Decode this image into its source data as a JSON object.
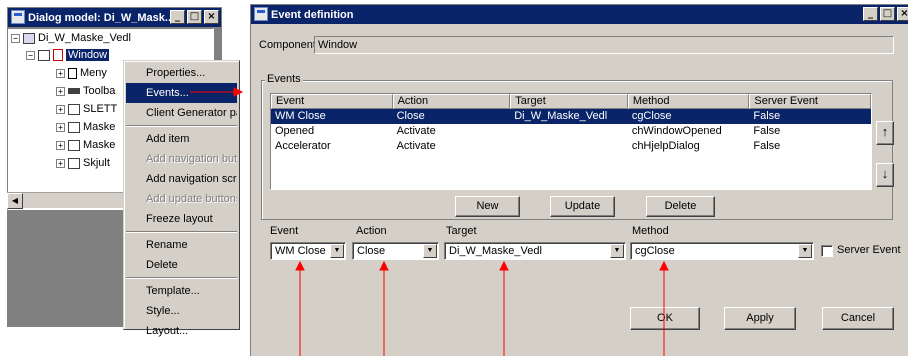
{
  "left_window": {
    "title": "Dialog model: Di_W_Mask...",
    "tree": {
      "root": "Di_W_Maske_Vedl",
      "selected": "Window",
      "children": [
        "Meny",
        "Toolba",
        "SLETT",
        "Maske",
        "Maske",
        "Skjult"
      ]
    }
  },
  "context_menu": {
    "items": [
      {
        "label": "Properties...",
        "state": "normal"
      },
      {
        "label": "Events...",
        "state": "highlighted"
      },
      {
        "label": "Client Generator para",
        "state": "normal"
      },
      {
        "label": "Add item",
        "state": "normal"
      },
      {
        "label": "Add navigation butto",
        "state": "disabled"
      },
      {
        "label": "Add navigation scroll",
        "state": "normal"
      },
      {
        "label": "Add update buttons",
        "state": "disabled"
      },
      {
        "label": "Freeze layout",
        "state": "normal"
      },
      {
        "label": "Rename",
        "state": "normal"
      },
      {
        "label": "Delete",
        "state": "normal"
      },
      {
        "label": "Template...",
        "state": "normal"
      },
      {
        "label": "Style...",
        "state": "normal"
      },
      {
        "label": "Layout...",
        "state": "normal"
      }
    ]
  },
  "dialog": {
    "title": "Event definition",
    "component_label": "Component",
    "component_value": "Window",
    "events_group_label": "Events",
    "columns": [
      "Event",
      "Action",
      "Target",
      "Method",
      "Server Event"
    ],
    "rows": [
      [
        "WM Close",
        "Close",
        "Di_W_Maske_Vedl",
        "cgClose",
        "False"
      ],
      [
        "Opened",
        "Activate",
        "",
        "chWindowOpened",
        "False"
      ],
      [
        "Accelerator",
        "Activate",
        "",
        "chHjelpDialog",
        "False"
      ]
    ],
    "selected_row": 0,
    "buttons": {
      "new": "New",
      "update": "Update",
      "delete": "Delete",
      "ok": "OK",
      "apply": "Apply",
      "cancel": "Cancel"
    },
    "move_up_icon": "arrow-up-icon",
    "move_down_icon": "arrow-down-icon",
    "form": {
      "event_label": "Event",
      "event_value": "WM Close",
      "action_label": "Action",
      "action_value": "Close",
      "target_label": "Target",
      "target_value": "Di_W_Maske_Vedl",
      "method_label": "Method",
      "method_value": "cgClose",
      "server_event_label": "Server Event",
      "server_event_checked": false
    }
  },
  "colors": {
    "annotation_arrow": "#ff0000",
    "titlebar": "#0a246a",
    "highlight": "#0a246a",
    "face": "#d4d0c8"
  }
}
